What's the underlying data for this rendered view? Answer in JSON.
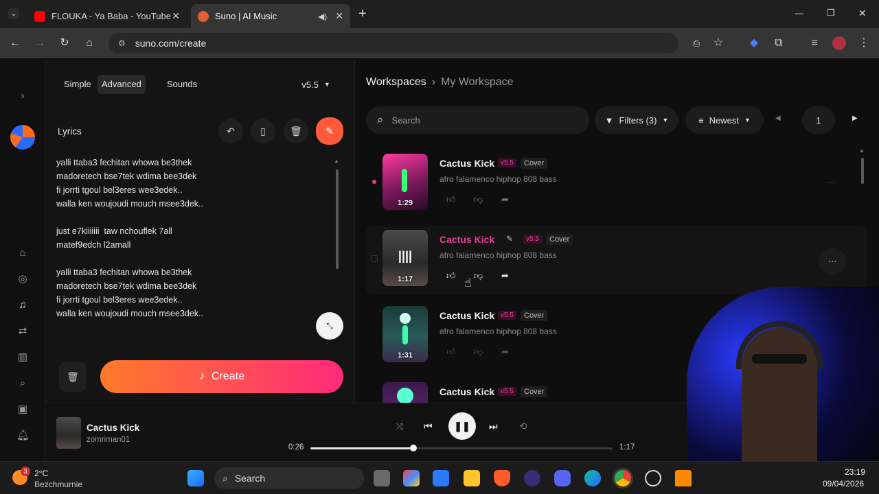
{
  "browser": {
    "tabs": [
      {
        "title": "FLOUKA - Ya Baba - YouTube",
        "close": "✕"
      },
      {
        "title": "Suno | AI Music",
        "close": "✕"
      }
    ],
    "new_tab": "+",
    "url": "suno.com/create",
    "window_controls": {
      "minimize": "—",
      "restore": "❐",
      "close": "✕"
    }
  },
  "left_panel": {
    "modes": [
      "Simple",
      "Advanced",
      "Sounds"
    ],
    "selected_mode": "Advanced",
    "model_version": "v5.5",
    "lyrics_label": "Lyrics",
    "lyrics_lines": [
      "yalli ttaba3 fechitan whowa be3thek",
      "madoretech bse7tek wdima bee3dek",
      "fi jorrti tgoul bel3eres wee3edek..",
      "walla ken woujoudi mouch msee3dek..",
      "",
      "just e7kiiiiiii  taw nchouflek 7all",
      "matef9edch l2amall",
      "",
      "yalli ttaba3 fechitan whowa be3thek",
      "madoretech bse7tek wdima bee3dek",
      "fi jorrti tgoul bel3eres wee3edek..",
      "walla ken woujoudi mouch msee3dek.."
    ],
    "create_label": "Create"
  },
  "right_panel": {
    "breadcrumb": {
      "root": "Workspaces",
      "current": "My Workspace"
    },
    "search_placeholder": "Search",
    "filters_label": "Filters (3)",
    "sort_label": "Newest",
    "page_number": "1",
    "songs": [
      {
        "title": "Cactus Kick",
        "version": "v5.5",
        "tag": "Cover",
        "description": "afro falamenco hiphop 808 bass",
        "duration": "1:29"
      },
      {
        "title": "Cactus Kick",
        "version": "v5.5",
        "tag": "Cover",
        "description": "afro falamenco hiphop 808 bass",
        "duration": "1:17"
      },
      {
        "title": "Cactus Kick",
        "version": "v5.5",
        "tag": "Cover",
        "description": "afro falamenco hiphop 808 bass",
        "duration": "1:31"
      },
      {
        "title": "Cactus Kick",
        "version": "v5.5",
        "tag": "Cover",
        "description": "",
        "duration": ""
      }
    ],
    "more_label": "···"
  },
  "player": {
    "title": "Cactus Kick",
    "artist": "zomriman01",
    "current_time": "0:26",
    "total_time": "1:17",
    "progress_fraction": 0.34
  },
  "taskbar": {
    "weather_temp": "2°C",
    "weather_location": "Bezchmurnie",
    "weather_badge": "3",
    "search_label": "Search",
    "time": "23:19",
    "date": "09/04/2026"
  },
  "colors": {
    "accent_pink": "#e0409a",
    "create_gradient_start": "#ff7a2a",
    "create_gradient_end": "#ff2a7a"
  }
}
